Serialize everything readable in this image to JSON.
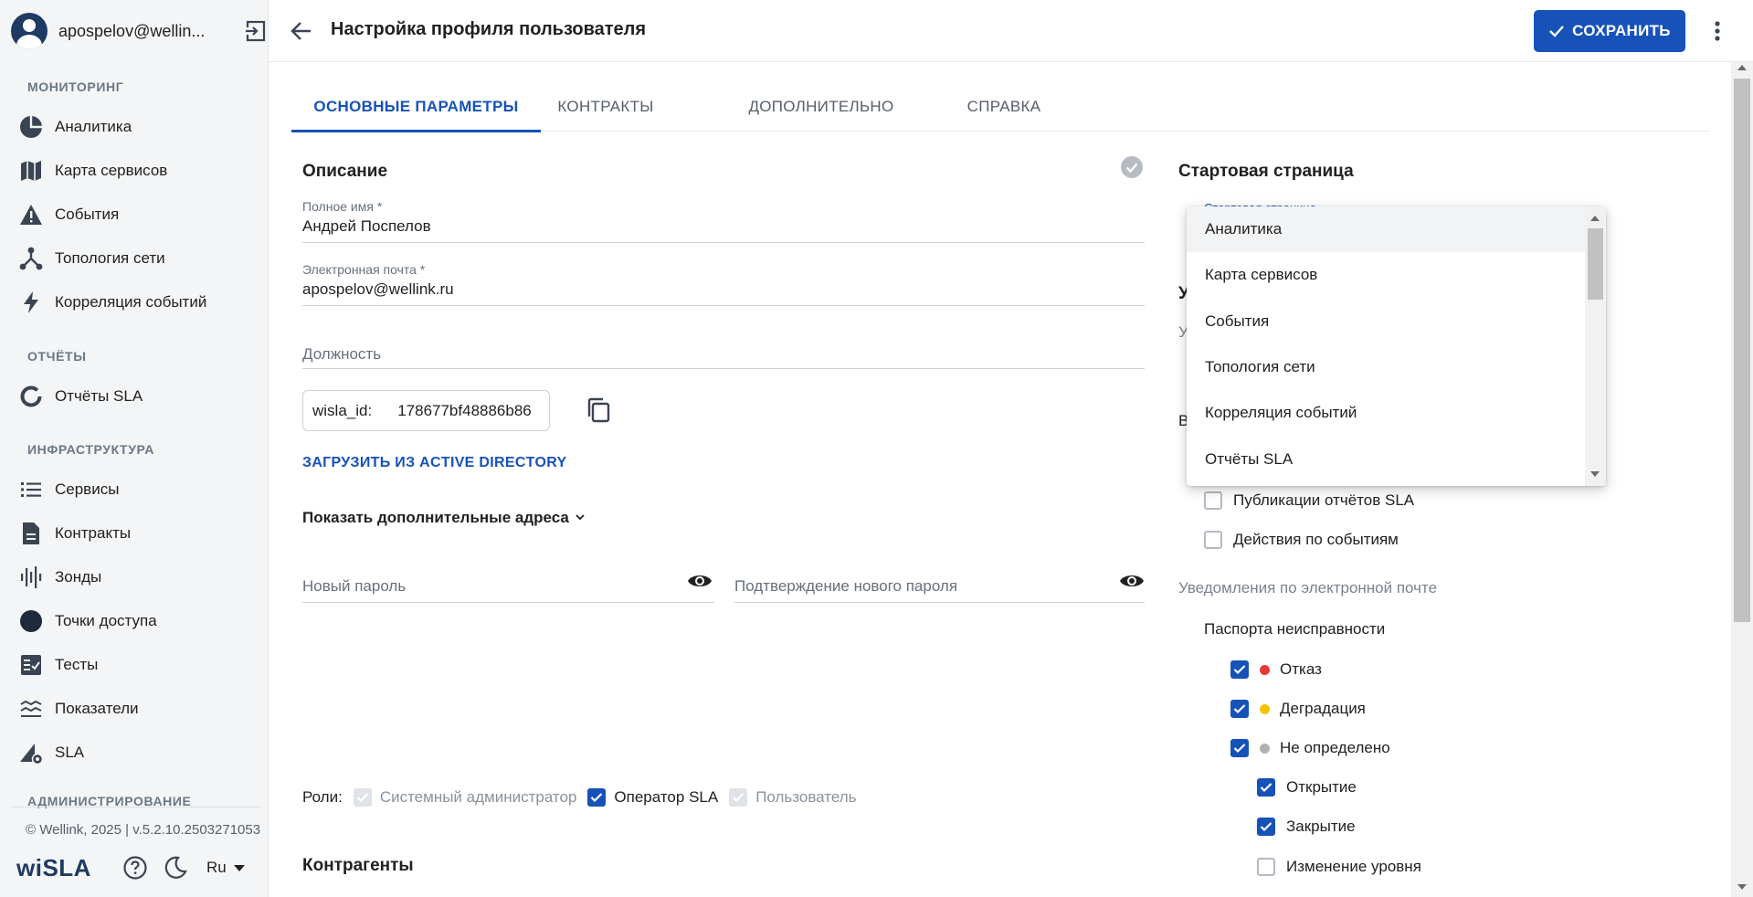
{
  "sidebar": {
    "user_name": "apospelov@wellin...",
    "sections": {
      "monitoring": "МОНИТОРИНГ",
      "reports": "ОТЧЁТЫ",
      "infrastructure": "ИНФРАСТРУКТУРА",
      "administration": "АДМИНИСТРИРОВАНИЕ"
    },
    "items": {
      "analytics": "Аналитика",
      "service_map": "Карта сервисов",
      "events": "События",
      "topology": "Топология сети",
      "correlation": "Корреляция событий",
      "sla_reports": "Отчёты SLA",
      "services": "Сервисы",
      "contracts": "Контракты",
      "probes": "Зонды",
      "access_points": "Точки доступа",
      "tests": "Тесты",
      "metrics": "Показатели",
      "sla": "SLA"
    },
    "footer": "© Wellink, 2025 | v.5.2.10.2503271053",
    "brand": "wiSLA",
    "language": "Ru"
  },
  "header": {
    "title": "Настройка профиля пользователя",
    "save_label": "СОХРАНИТЬ"
  },
  "tabs": {
    "main": "ОСНОВНЫЕ ПАРАМЕТРЫ",
    "contracts": "КОНТРАКТЫ",
    "additional": "ДОПОЛНИТЕЛЬНО",
    "help": "СПРАВКА"
  },
  "form": {
    "description_title": "Описание",
    "full_name_label": "Полное имя *",
    "full_name_value": "Андрей Поспелов",
    "email_label": "Электронная почта *",
    "email_value": "apospelov@wellink.ru",
    "position_placeholder": "Должность",
    "wisla_id_label": "wisla_id:",
    "wisla_id_value": "178677bf48886b86",
    "load_ad": "ЗАГРУЗИТЬ ИЗ ACTIVE DIRECTORY",
    "show_more": "Показать дополнительные адреса",
    "new_password_placeholder": "Новый пароль",
    "confirm_password_placeholder": "Подтверждение нового пароля",
    "roles_label": "Роли:",
    "roles": {
      "sysadmin": "Системный администратор",
      "sla_operator": "Оператор SLA",
      "user": "Пользователь"
    },
    "counterparties_title": "Контрагенты"
  },
  "right": {
    "start_page_title": "Стартовая страница",
    "start_page_field_label": "Стартовая страница",
    "partial_heading": "У",
    "partial_sub": "У",
    "partial_b": "В",
    "sla_publications": "Публикации отчётов SLA",
    "event_actions": "Действия по событиям",
    "email_notifications": "Уведомления по электронной почте",
    "fault_passports": "Паспорта неисправности",
    "failure": "Отказ",
    "degradation": "Деградация",
    "undefined": "Не определено",
    "opening": "Открытие",
    "closing": "Закрытие",
    "level_change": "Изменение уровня"
  },
  "dropdown": {
    "options": [
      "Аналитика",
      "Карта сервисов",
      "События",
      "Топология сети",
      "Корреляция событий",
      "Отчёты SLA"
    ]
  },
  "colors": {
    "accent": "#1652b8",
    "failure_dot": "#e53935",
    "degradation_dot": "#f5c400",
    "undefined_dot": "#b0b0b0"
  }
}
